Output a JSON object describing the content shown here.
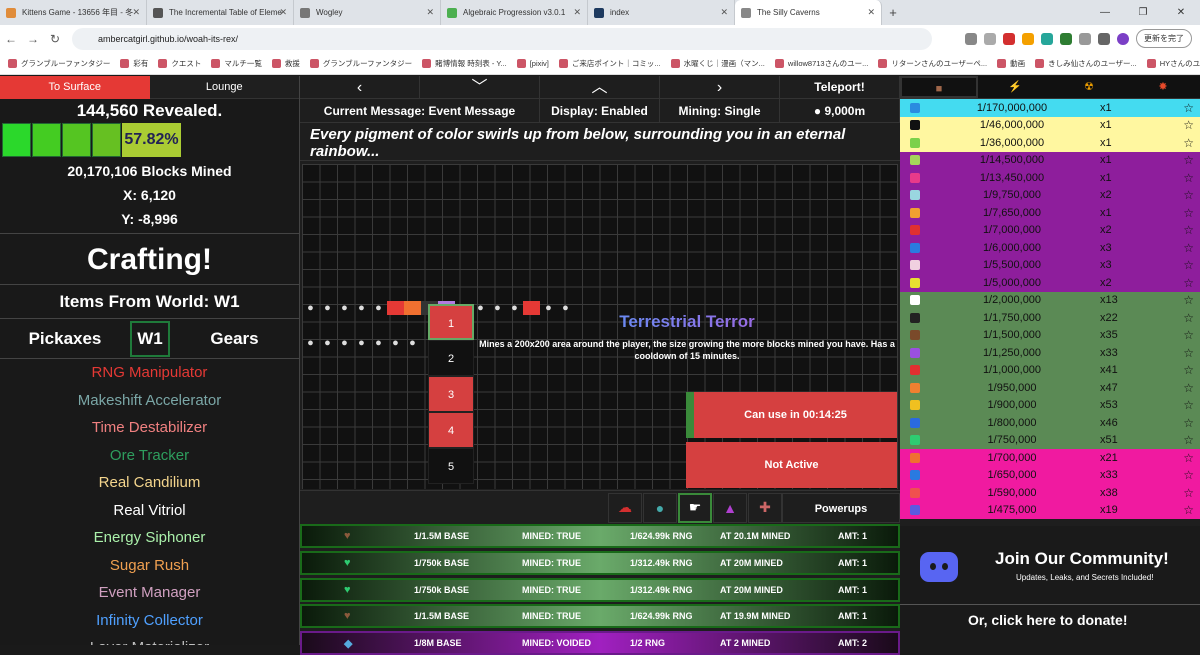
{
  "browser": {
    "tabs": [
      {
        "title": "Kittens Game - 13656 年目 - 冬",
        "color": "#e08c3a"
      },
      {
        "title": "The Incremental Table of Eleme",
        "color": "#555"
      },
      {
        "title": "Wogley",
        "color": "#777"
      },
      {
        "title": "Algebraic Progression v3.0.1",
        "color": "#4caf50"
      },
      {
        "title": "index",
        "color": "#1e3a5f"
      },
      {
        "title": "The Silly Caverns",
        "color": "#888"
      }
    ],
    "url": "ambercatgirl.github.io/woah-its-rex/",
    "update_label": "更新を完了",
    "bookmarks": [
      "グランブルーファンタジー",
      "彩有",
      "クエスト",
      "マルチ一覧",
      "救援",
      "グランブルーファンタジー",
      "賭博情報 時刻表 - Y...",
      "[pixiv]",
      "ご来店ポイント｜コミッ...",
      "水曜くじ｜漫画（マン...",
      "willow8713さんのユー...",
      "リターンさんのユーザーペ...",
      "動画",
      "きしみ仙さんのユーザー...",
      "HYさんのユーザーページ..."
    ]
  },
  "left": {
    "to_surface": "To Surface",
    "lounge": "Lounge",
    "revealed": "144,560 Revealed.",
    "progress_pct": "57.82%",
    "blocks_mined": "20,170,106 Blocks Mined",
    "x": "X: 6,120",
    "y": "Y: -8,996",
    "crafting": "Crafting!",
    "items_from": "Items From World: W1",
    "pickaxes": "Pickaxes",
    "world": "W1",
    "gears": "Gears",
    "tools": [
      {
        "name": "RNG Manipulator",
        "color": "#e53935"
      },
      {
        "name": "Makeshift Accelerator",
        "color": "#7aa6a6"
      },
      {
        "name": "Time Destabilizer",
        "color": "#f08080"
      },
      {
        "name": "Ore Tracker",
        "color": "#2e9e5e"
      },
      {
        "name": "Real Candilium",
        "color": "#f4d58d"
      },
      {
        "name": "Real Vitriol",
        "color": "#ffffff"
      },
      {
        "name": "Energy Siphoner",
        "color": "#aaf0aa"
      },
      {
        "name": "Sugar Rush",
        "color": "#f0a050"
      },
      {
        "name": "Event Manager",
        "color": "#d0a0c0"
      },
      {
        "name": "Infinity Collector",
        "color": "#4fa0ff"
      },
      {
        "name": "Layer Materializer",
        "color": "#c0c0c0"
      }
    ]
  },
  "mid": {
    "arrows": [
      "‹",
      "﹀",
      "︿",
      "›"
    ],
    "teleport": "Teleport!",
    "current_message": "Current Message: Event Message",
    "display": "Display: Enabled",
    "mining": "Mining: Single",
    "depth": "9,000m",
    "message": "Every pigment of color swirls up from below, surrounding you in an eternal rainbow...",
    "slots": [
      "1",
      "2",
      "3",
      "4",
      "5"
    ],
    "power_title": "Terrestrial Terror",
    "power_desc": "Mines a 200x200 area around the player, the size growing the more blocks mined you have. Has a cooldown of 15 minutes.",
    "can_use": "Can use in 00:14:25",
    "not_active": "Not Active",
    "powerups": "Powerups",
    "log": [
      {
        "base": "1/1.5M BASE",
        "mined": "MINED: TRUE",
        "rng": "1/624.99k RNG",
        "at": "AT 20.1M MINED",
        "amt": "AMT: 1",
        "icon": "♥",
        "icolor": "#8b5a3c"
      },
      {
        "base": "1/750k BASE",
        "mined": "MINED: TRUE",
        "rng": "1/312.49k RNG",
        "at": "AT 20M MINED",
        "amt": "AMT: 1",
        "icon": "♥",
        "icolor": "#2ecc71"
      },
      {
        "base": "1/750k BASE",
        "mined": "MINED: TRUE",
        "rng": "1/312.49k RNG",
        "at": "AT 20M MINED",
        "amt": "AMT: 1",
        "icon": "♥",
        "icolor": "#2ecc71"
      },
      {
        "base": "1/1.5M BASE",
        "mined": "MINED: TRUE",
        "rng": "1/624.99k RNG",
        "at": "AT 19.9M MINED",
        "amt": "AMT: 1",
        "icon": "♥",
        "icolor": "#8b5a3c"
      },
      {
        "base": "1/8M BASE",
        "mined": "MINED: VOIDED",
        "rng": "1/2 RNG",
        "at": "AT 2 MINED",
        "amt": "AMT: 2",
        "icon": "◆",
        "icolor": "#5ad"
      }
    ]
  },
  "right": {
    "tabs": [
      "■",
      "⚡",
      "☢",
      "✸"
    ],
    "ores": [
      {
        "odds": "1/170,000,000",
        "count": "x1",
        "bg": "#44dbf0",
        "icon": "#2a8be0"
      },
      {
        "odds": "1/46,000,000",
        "count": "x1",
        "bg": "#fff7a0",
        "icon": "#111"
      },
      {
        "odds": "1/36,000,000",
        "count": "x1",
        "bg": "#fff7a0",
        "icon": "#7bd14a"
      },
      {
        "odds": "1/14,500,000",
        "count": "x1",
        "bg": "#8e1e9c",
        "icon": "#a5d65a"
      },
      {
        "odds": "1/13,450,000",
        "count": "x1",
        "bg": "#8e1e9c",
        "icon": "#e83a8a"
      },
      {
        "odds": "1/9,750,000",
        "count": "x2",
        "bg": "#8e1e9c",
        "icon": "#9ad6e0"
      },
      {
        "odds": "1/7,650,000",
        "count": "x1",
        "bg": "#8e1e9c",
        "icon": "#f0a030"
      },
      {
        "odds": "1/7,000,000",
        "count": "x2",
        "bg": "#8e1e9c",
        "icon": "#e03030"
      },
      {
        "odds": "1/6,000,000",
        "count": "x3",
        "bg": "#8e1e9c",
        "icon": "#2a7ae0"
      },
      {
        "odds": "1/5,500,000",
        "count": "x3",
        "bg": "#8e1e9c",
        "icon": "#f0d0e0"
      },
      {
        "odds": "1/5,000,000",
        "count": "x2",
        "bg": "#8e1e9c",
        "icon": "#e8e030"
      },
      {
        "odds": "1/2,000,000",
        "count": "x13",
        "bg": "#5b8a55",
        "icon": "#ffffff"
      },
      {
        "odds": "1/1,750,000",
        "count": "x22",
        "bg": "#5b8a55",
        "icon": "#222"
      },
      {
        "odds": "1/1,500,000",
        "count": "x35",
        "bg": "#5b8a55",
        "icon": "#7a4a2a"
      },
      {
        "odds": "1/1,250,000",
        "count": "x33",
        "bg": "#5b8a55",
        "icon": "#9a50e0"
      },
      {
        "odds": "1/1,000,000",
        "count": "x41",
        "bg": "#5b8a55",
        "icon": "#e03030"
      },
      {
        "odds": "1/950,000",
        "count": "x47",
        "bg": "#5b8a55",
        "icon": "#f08030"
      },
      {
        "odds": "1/900,000",
        "count": "x53",
        "bg": "#5b8a55",
        "icon": "#f0c020"
      },
      {
        "odds": "1/800,000",
        "count": "x46",
        "bg": "#5b8a55",
        "icon": "#2a6ae0"
      },
      {
        "odds": "1/750,000",
        "count": "x51",
        "bg": "#5b8a55",
        "icon": "#2ecc71"
      },
      {
        "odds": "1/700,000",
        "count": "x21",
        "bg": "#f01aa0",
        "icon": "#f07030"
      },
      {
        "odds": "1/650,000",
        "count": "x33",
        "bg": "#f01aa0",
        "icon": "#2a7ae0"
      },
      {
        "odds": "1/590,000",
        "count": "x38",
        "bg": "#f01aa0",
        "icon": "#f05050"
      },
      {
        "odds": "1/475,000",
        "count": "x19",
        "bg": "#f01aa0",
        "icon": "#5a5ae0"
      }
    ],
    "community_title": "Join Our Community!",
    "community_sub": "Updates, Leaks, and Secrets Included!",
    "donate": "Or, click here to donate!"
  }
}
